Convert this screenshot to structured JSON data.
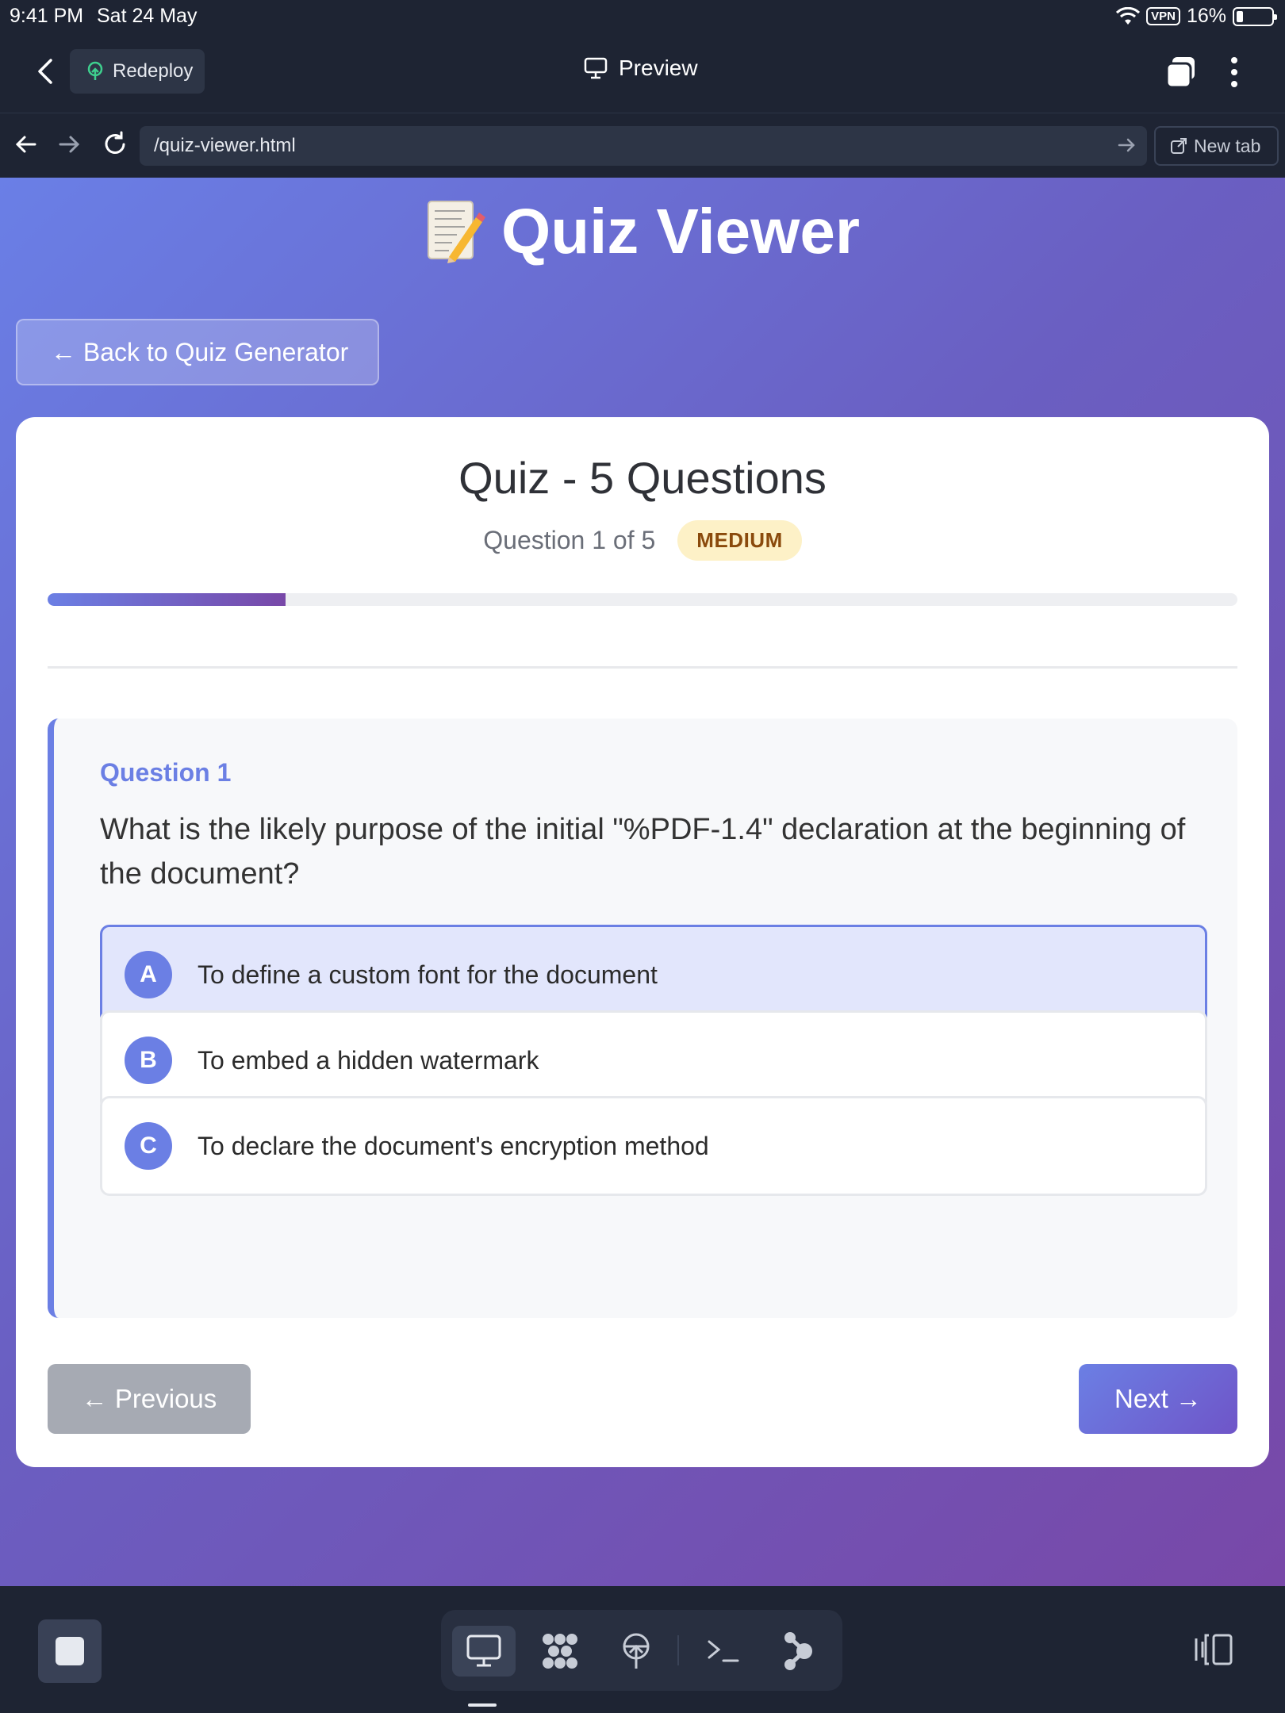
{
  "status_bar": {
    "time": "9:41 PM",
    "date": "Sat 24 May",
    "vpn": "VPN",
    "battery": "16%"
  },
  "top_nav": {
    "redeploy_label": "Redeploy",
    "preview_label": "Preview"
  },
  "url_bar": {
    "url": "/quiz-viewer.html",
    "new_tab_label": "New tab"
  },
  "page": {
    "title": "Quiz Viewer",
    "back_button": "← Back to Quiz Generator",
    "quiz_title": "Quiz - 5 Questions",
    "question_count": "Question 1 of 5",
    "difficulty": "MEDIUM",
    "progress_fraction": 0.2,
    "question": {
      "label": "Question 1",
      "text": "What is the likely purpose of the initial \"%PDF-1.4\" declaration at the beginning of the document?",
      "options": [
        {
          "letter": "A",
          "text": "To define a custom font for the document",
          "selected": true
        },
        {
          "letter": "B",
          "text": "To embed a hidden watermark",
          "selected": false
        },
        {
          "letter": "C",
          "text": "To declare the document's encryption method",
          "selected": false
        }
      ]
    },
    "prev_button": "← Previous",
    "next_button": "Next →"
  },
  "colors": {
    "accent": "#6b7fe4",
    "gradient_end": "#7848a8",
    "badge_bg": "#fdf1c7",
    "badge_text": "#8a4a0c",
    "chrome": "#1e2433"
  },
  "dock": {
    "items": [
      "desktop-icon",
      "apps-icon",
      "deploy-icon",
      "terminal-icon",
      "flow-icon"
    ]
  }
}
